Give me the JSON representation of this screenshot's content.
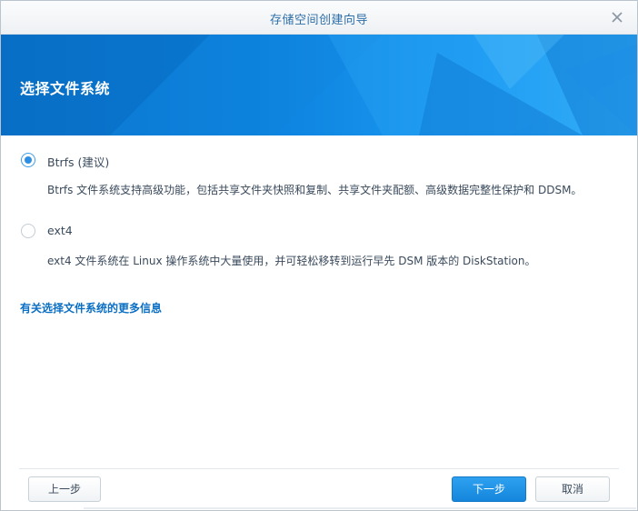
{
  "dialog": {
    "title": "存储空间创建向导",
    "close_icon": "close-icon"
  },
  "banner": {
    "heading": "选择文件系统"
  },
  "options": [
    {
      "id": "btrfs",
      "label": "Btrfs (建议)",
      "description": "Btrfs 文件系统支持高级功能，包括共享文件夹快照和复制、共享文件夹配额、高级数据完整性保护和 DDSM。",
      "selected": true
    },
    {
      "id": "ext4",
      "label": "ext4",
      "description": "ext4 文件系统在 Linux 操作系统中大量使用，并可轻松移转到运行早先 DSM 版本的 DiskStation。",
      "selected": false
    }
  ],
  "more_info_link": "有关选择文件系统的更多信息",
  "footer": {
    "back_label": "上一步",
    "next_label": "下一步",
    "cancel_label": "取消"
  },
  "colors": {
    "accent": "#1586dc",
    "link": "#0b6fc4",
    "banner_start": "#0870c8",
    "banner_end": "#36b0f8"
  }
}
